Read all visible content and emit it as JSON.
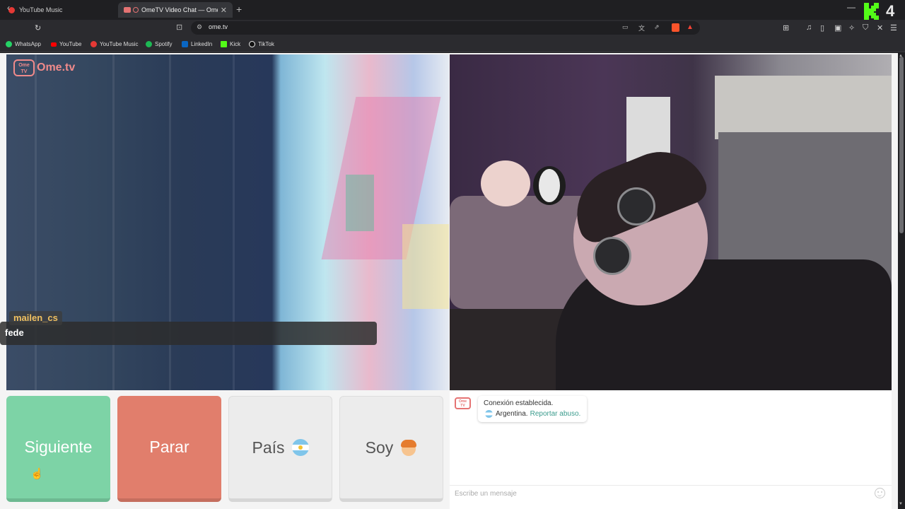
{
  "browser": {
    "tabs": [
      {
        "label": "YouTube Music"
      },
      {
        "label": "OmeTV Video Chat — Omeg"
      }
    ],
    "address": "ome.tv",
    "bookmarks": [
      {
        "label": "WhatsApp",
        "color": "#25d366"
      },
      {
        "label": "YouTube",
        "color": "#ff0000"
      },
      {
        "label": "YouTube Music",
        "color": "#e53935"
      },
      {
        "label": "Spotify",
        "color": "#1db954"
      },
      {
        "label": "LinkedIn",
        "color": "#0a66c2"
      },
      {
        "label": "Kick",
        "color": "#53fc18"
      },
      {
        "label": "TikTok",
        "color": "#ffffff"
      }
    ],
    "overlay_counter": "4"
  },
  "page": {
    "logo": {
      "box_line1": "Ome",
      "box_line2": "TV",
      "text": "Ome.tv"
    },
    "chat_overlay": {
      "username": "mailen_cs",
      "message": "fede"
    },
    "buttons": {
      "next": "Siguiente",
      "stop": "Parar",
      "country": "País",
      "gender": "Soy"
    },
    "system_message": {
      "line1": "Conexión establecida.",
      "country": "Argentina.",
      "report_link": "Reportar abuso."
    },
    "input": {
      "placeholder": "Escribe un mensaje"
    }
  },
  "colors": {
    "next_button": "#7dd3a6",
    "stop_button": "#e17e6c",
    "brand": "#f08a8a",
    "link": "#3a9b8c"
  }
}
